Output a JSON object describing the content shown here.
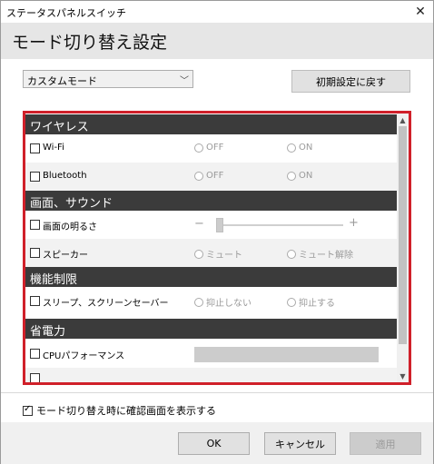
{
  "window": {
    "title": "ステータスパネルスイッチ",
    "close_glyph": "✕"
  },
  "header": {
    "title": "モード切り替え設定"
  },
  "mode_select": {
    "value": "カスタムモード",
    "chevron": "﹀"
  },
  "reset_button": {
    "label": "初期設定に戻す"
  },
  "sections": {
    "wireless": "ワイヤレス",
    "display_sound": "画面、サウンド",
    "restriction": "機能制限",
    "power": "省電力"
  },
  "rows": {
    "wifi": {
      "label": "Wi-Fi",
      "opt1": "OFF",
      "opt2": "ON"
    },
    "bluetooth": {
      "label": "Bluetooth",
      "opt1": "OFF",
      "opt2": "ON"
    },
    "brightness": {
      "label": "画面の明るさ",
      "minus": "−",
      "plus": "+"
    },
    "speaker": {
      "label": "スピーカー",
      "opt1": "ミュート",
      "opt2": "ミュート解除"
    },
    "sleep": {
      "label": "スリープ、スクリーンセーバー",
      "opt1": "抑止しない",
      "opt2": "抑止する"
    },
    "cpu": {
      "label": "CPUパフォーマンス"
    }
  },
  "scrollbar": {
    "up": "▲",
    "down": "▼"
  },
  "confirm": {
    "label": "モード切り替え時に確認画面を表示する",
    "checked": true
  },
  "footer": {
    "ok": "OK",
    "cancel": "キャンセル",
    "apply": "適用"
  },
  "colors": {
    "panel_border": "#d0202a",
    "section_bg": "#3b3b3b",
    "header_bg": "#e6e6e6"
  }
}
